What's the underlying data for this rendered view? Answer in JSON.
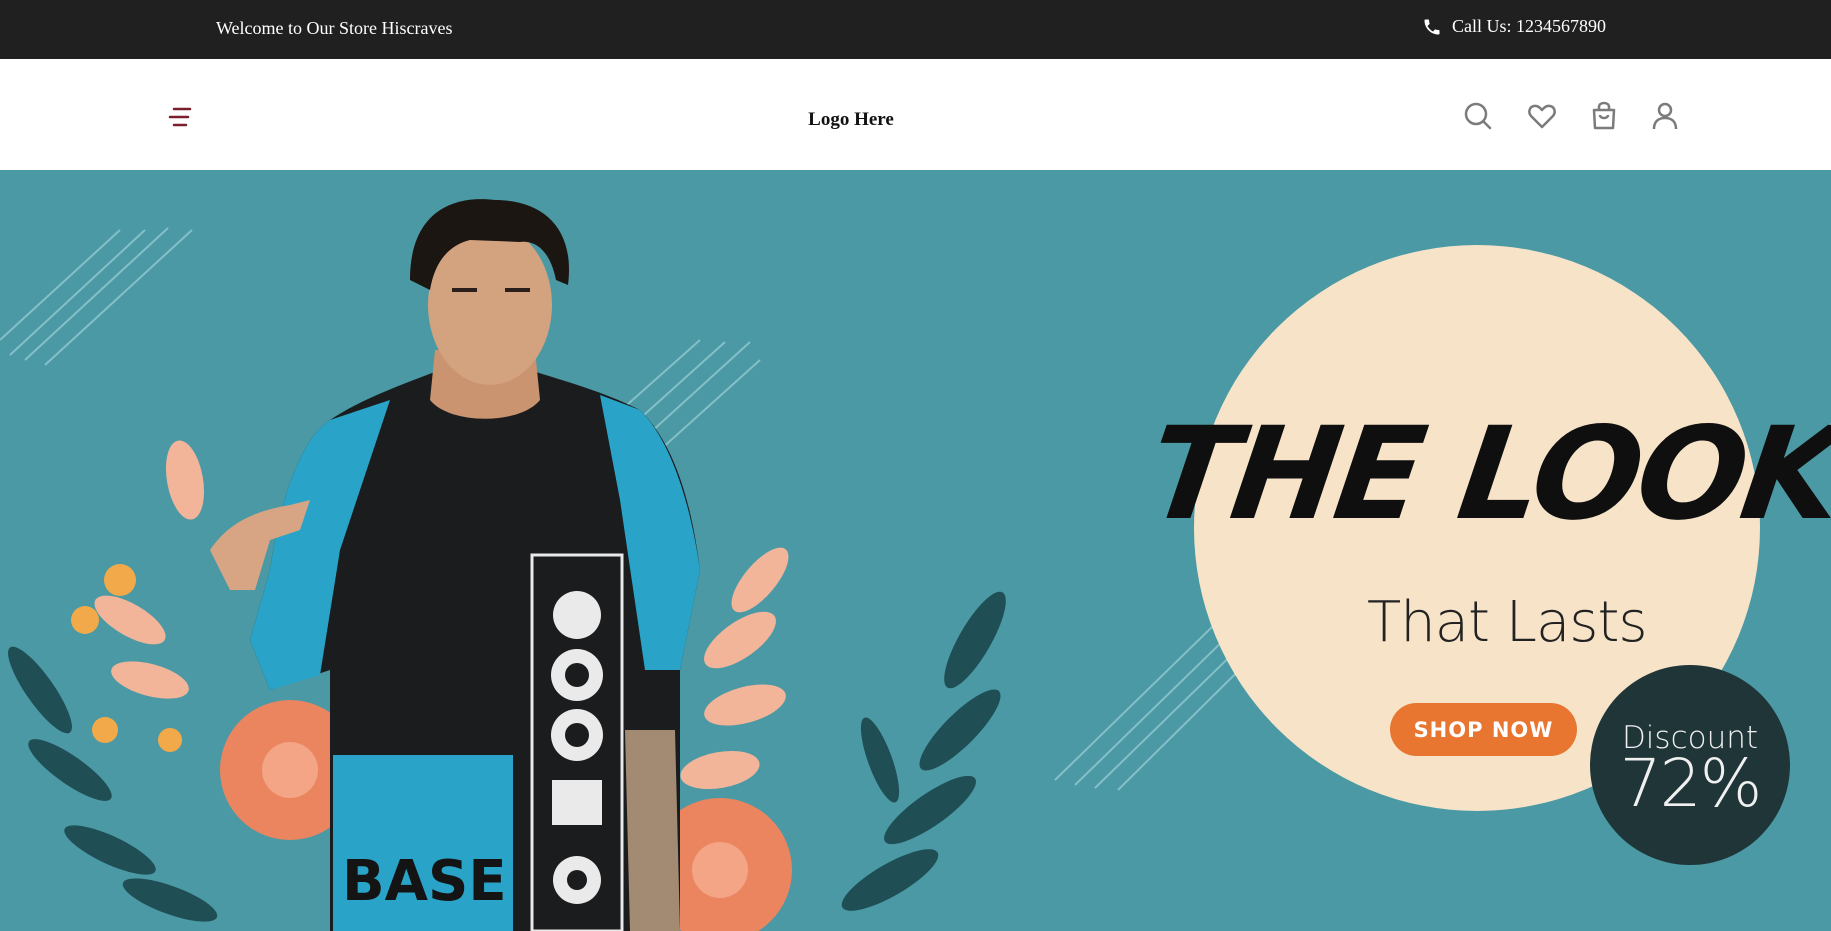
{
  "topbar": {
    "welcome": "Welcome to Our Store Hiscraves",
    "call": "Call Us: 1234567890",
    "phone_icon": "phone-icon"
  },
  "header": {
    "logo": "Logo Here",
    "icons": [
      "menu-icon",
      "search-icon",
      "heart-icon",
      "bag-icon",
      "user-icon"
    ]
  },
  "hero": {
    "headline": "THE LOOK",
    "subheadline": "That Lasts",
    "cta": "SHOP NOW",
    "discount_label": "Discount",
    "discount_value": "72%"
  },
  "colors": {
    "topbar_bg": "#202020",
    "hero_bg": "#4a99a4",
    "circle": "#f6e3c8",
    "cta": "#e87530",
    "badge": "#1f3538",
    "menu_icon": "#7a1f2b"
  }
}
